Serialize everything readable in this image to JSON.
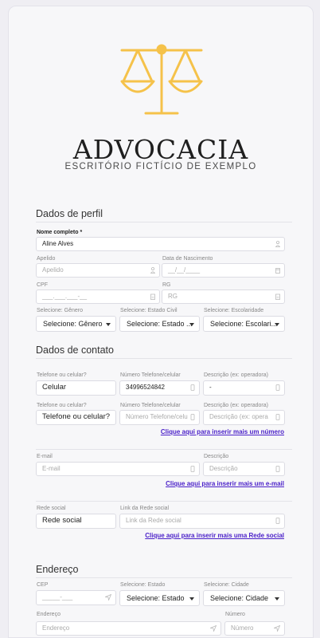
{
  "brand": {
    "title": "ADVOCACIA",
    "subtitle": "ESCRITÓRIO FICTÍCIO DE EXEMPLO",
    "accent": "#f5c24a"
  },
  "profile": {
    "section_title": "Dados de perfil",
    "full_name": {
      "label": "Nome completo *",
      "value": "Aline Alves"
    },
    "nickname": {
      "label": "Apelido",
      "placeholder": "Apelido"
    },
    "birth": {
      "label": "Data de Nascimento",
      "placeholder": "__/__/____"
    },
    "cpf": {
      "label": "CPF",
      "placeholder": "___.___.___-__"
    },
    "rg": {
      "label": "RG",
      "placeholder": "RG"
    },
    "gender": {
      "label": "Selecione: Gênero",
      "value": "Selecione: Gênero"
    },
    "marital": {
      "label": "Selecione: Estado Civil",
      "value": "Selecione: Estado ..."
    },
    "education": {
      "label": "Selecione: Escolaridade",
      "value": "Selecione: Escolari..."
    }
  },
  "contact": {
    "section_title": "Dados de contato",
    "phones": [
      {
        "type_label": "Telefone ou celular?",
        "type_value": "Celular",
        "number_label": "Número Telefone/celular",
        "number_value": "34996524842",
        "desc_label": "Descrição (ex: operadora)",
        "desc_value": "-"
      },
      {
        "type_label": "Telefone ou celular?",
        "type_value": "Telefone ou celular?",
        "number_label": "Número Telefone/celular",
        "number_placeholder": "Número Telefone/celu",
        "desc_label": "Descrição (ex: operadora)",
        "desc_placeholder": "Descrição (ex: opera"
      }
    ],
    "add_phone": "Clique aqui para inserir mais um número",
    "email": {
      "label": "E-mail",
      "placeholder": "E-mail"
    },
    "email_desc": {
      "label": "Descrição",
      "placeholder": "Descrição"
    },
    "add_email": "Clique aqui para inserir mais um e-mail",
    "social": {
      "label": "Rede social",
      "value": "Rede social"
    },
    "social_link": {
      "label": "Link da Rede social",
      "placeholder": "Link da Rede social"
    },
    "add_social": "Clique aqui para inserir mais uma Rede social"
  },
  "address": {
    "section_title": "Endereço",
    "cep": {
      "label": "CEP",
      "placeholder": "_____-___"
    },
    "state": {
      "label": "Selecione: Estado",
      "value": "Selecione: Estado"
    },
    "city": {
      "label": "Selecione: Cidade",
      "value": "Selecione: Cidade"
    },
    "street": {
      "label": "Endereço",
      "placeholder": "Endereço"
    },
    "number": {
      "label": "Número",
      "placeholder": "Número"
    }
  }
}
